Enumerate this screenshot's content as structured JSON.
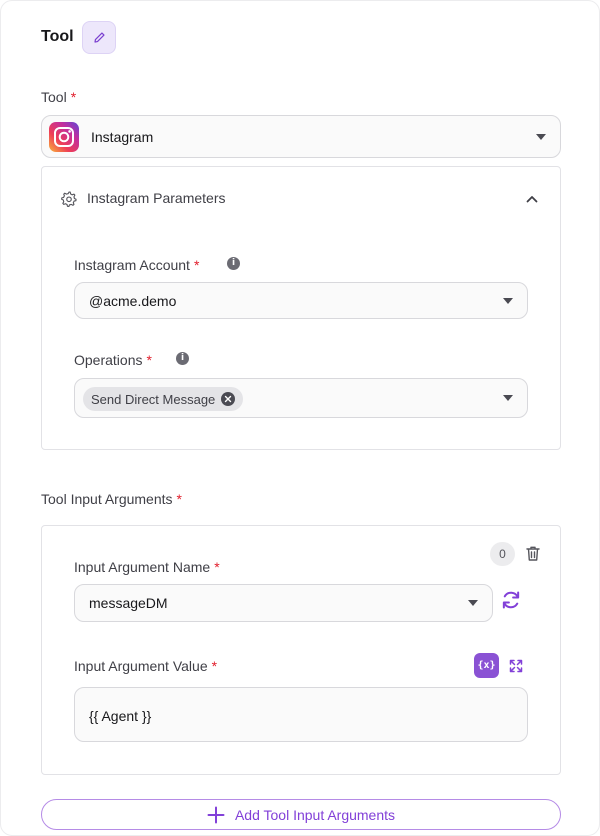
{
  "header": {
    "title": "Tool"
  },
  "tool": {
    "label": "Tool",
    "required_mark": "*",
    "selected": "Instagram",
    "icon": "instagram-logo-icon"
  },
  "params": {
    "title": "Instagram Parameters",
    "account": {
      "label": "Instagram Account",
      "required_mark": "*",
      "value": "@acme.demo"
    },
    "operations": {
      "label": "Operations",
      "required_mark": "*",
      "chips": [
        "Send Direct Message"
      ]
    }
  },
  "args": {
    "label": "Tool Input Arguments",
    "required_mark": "*",
    "items": [
      {
        "index": "0",
        "name_label": "Input Argument Name",
        "name_value": "messageDM",
        "value_label": "Input Argument Value",
        "value": "{{ Agent }}",
        "var_button": "{x}"
      }
    ],
    "add_label": "Add Tool Input Arguments"
  },
  "colors": {
    "accent": "#8240d8",
    "required": "#e11d2b"
  }
}
